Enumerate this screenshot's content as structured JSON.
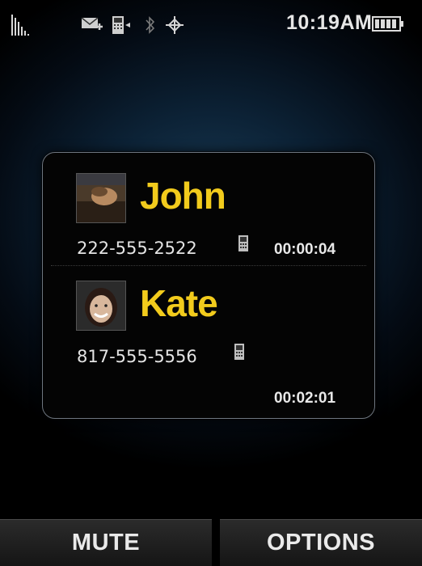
{
  "status_bar": {
    "time": "10:19AM",
    "icons": [
      "signal-icon",
      "message-icon",
      "device-icon",
      "bluetooth-icon",
      "gps-icon",
      "battery-icon"
    ]
  },
  "calls": [
    {
      "name": "John",
      "number": "222-555-2522",
      "duration": "00:00:04",
      "number_type_icon": "mobile-phone-icon"
    },
    {
      "name": "Kate",
      "number": "817-555-5556",
      "duration": "00:02:01",
      "number_type_icon": "mobile-phone-icon"
    }
  ],
  "softkeys": {
    "left": "MUTE",
    "right": "OPTIONS"
  },
  "colors": {
    "name": "#f2cb1c",
    "background": "#0c2236"
  }
}
